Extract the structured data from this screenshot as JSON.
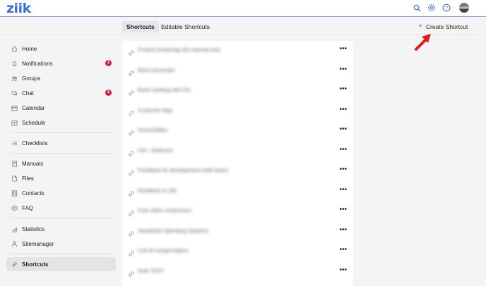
{
  "app": {
    "logo": "ziik"
  },
  "header": {
    "icons": [
      "search-icon",
      "gear-icon",
      "help-icon",
      "avatar"
    ]
  },
  "tabs": [
    {
      "label": "Shortcuts",
      "active": true
    },
    {
      "label": "Editable Shortcuts",
      "active": false
    }
  ],
  "create_button": {
    "label": "Create Shortcut",
    "icon": "plus-icon"
  },
  "sidebar": {
    "items": [
      {
        "label": "Home",
        "icon": "home-icon",
        "badge": null
      },
      {
        "label": "Notifications",
        "icon": "bell-icon",
        "badge": "1"
      },
      {
        "label": "Groups",
        "icon": "groups-icon",
        "badge": null
      },
      {
        "label": "Chat",
        "icon": "chat-icon",
        "badge": "1"
      },
      {
        "label": "Calendar",
        "icon": "calendar-icon",
        "badge": null
      },
      {
        "label": "Schedule",
        "icon": "schedule-icon",
        "badge": null
      },
      {
        "label": "Checklists",
        "icon": "checklist-icon",
        "badge": null
      },
      {
        "label": "Manuals",
        "icon": "manual-icon",
        "badge": null
      },
      {
        "label": "Files",
        "icon": "files-icon",
        "badge": null
      },
      {
        "label": "Contacts",
        "icon": "contacts-icon",
        "badge": null
      },
      {
        "label": "FAQ",
        "icon": "faq-icon",
        "badge": null
      },
      {
        "label": "Statistics",
        "icon": "statistics-icon",
        "badge": null
      },
      {
        "label": "Sitemanager",
        "icon": "sitemanager-icon",
        "badge": null
      },
      {
        "label": "Shortcuts",
        "icon": "link-icon",
        "badge": null,
        "active": true
      }
    ]
  },
  "shortcuts": [
    {
      "title": "Product Roadmap (for internal use)"
    },
    {
      "title": "Bank Generator"
    },
    {
      "title": "Book meeting with Per"
    },
    {
      "title": "Customer Map"
    },
    {
      "title": "Demo/Slides"
    },
    {
      "title": "CRI - Redmine"
    },
    {
      "title": "Feedback for development (with team)"
    },
    {
      "title": "Feedback to Ziik"
    },
    {
      "title": "Free video compressor"
    },
    {
      "title": "Standards Operating Systems"
    },
    {
      "title": "Link til mergermakers"
    },
    {
      "title": "Ruth TEST"
    }
  ],
  "row_more_label": "•••",
  "colors": {
    "accent": "#3b6fd6",
    "badge": "#d91c3b",
    "arrow": "#e01b1b"
  }
}
